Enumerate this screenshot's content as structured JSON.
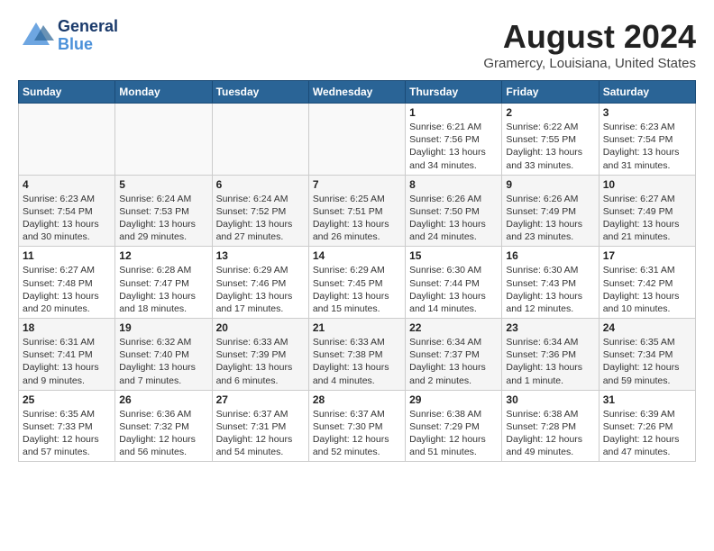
{
  "header": {
    "logo_general": "General",
    "logo_blue": "Blue",
    "month_title": "August 2024",
    "location": "Gramercy, Louisiana, United States"
  },
  "weekdays": [
    "Sunday",
    "Monday",
    "Tuesday",
    "Wednesday",
    "Thursday",
    "Friday",
    "Saturday"
  ],
  "weeks": [
    [
      {
        "day": "",
        "info": ""
      },
      {
        "day": "",
        "info": ""
      },
      {
        "day": "",
        "info": ""
      },
      {
        "day": "",
        "info": ""
      },
      {
        "day": "1",
        "info": "Sunrise: 6:21 AM\nSunset: 7:56 PM\nDaylight: 13 hours\nand 34 minutes."
      },
      {
        "day": "2",
        "info": "Sunrise: 6:22 AM\nSunset: 7:55 PM\nDaylight: 13 hours\nand 33 minutes."
      },
      {
        "day": "3",
        "info": "Sunrise: 6:23 AM\nSunset: 7:54 PM\nDaylight: 13 hours\nand 31 minutes."
      }
    ],
    [
      {
        "day": "4",
        "info": "Sunrise: 6:23 AM\nSunset: 7:54 PM\nDaylight: 13 hours\nand 30 minutes."
      },
      {
        "day": "5",
        "info": "Sunrise: 6:24 AM\nSunset: 7:53 PM\nDaylight: 13 hours\nand 29 minutes."
      },
      {
        "day": "6",
        "info": "Sunrise: 6:24 AM\nSunset: 7:52 PM\nDaylight: 13 hours\nand 27 minutes."
      },
      {
        "day": "7",
        "info": "Sunrise: 6:25 AM\nSunset: 7:51 PM\nDaylight: 13 hours\nand 26 minutes."
      },
      {
        "day": "8",
        "info": "Sunrise: 6:26 AM\nSunset: 7:50 PM\nDaylight: 13 hours\nand 24 minutes."
      },
      {
        "day": "9",
        "info": "Sunrise: 6:26 AM\nSunset: 7:49 PM\nDaylight: 13 hours\nand 23 minutes."
      },
      {
        "day": "10",
        "info": "Sunrise: 6:27 AM\nSunset: 7:49 PM\nDaylight: 13 hours\nand 21 minutes."
      }
    ],
    [
      {
        "day": "11",
        "info": "Sunrise: 6:27 AM\nSunset: 7:48 PM\nDaylight: 13 hours\nand 20 minutes."
      },
      {
        "day": "12",
        "info": "Sunrise: 6:28 AM\nSunset: 7:47 PM\nDaylight: 13 hours\nand 18 minutes."
      },
      {
        "day": "13",
        "info": "Sunrise: 6:29 AM\nSunset: 7:46 PM\nDaylight: 13 hours\nand 17 minutes."
      },
      {
        "day": "14",
        "info": "Sunrise: 6:29 AM\nSunset: 7:45 PM\nDaylight: 13 hours\nand 15 minutes."
      },
      {
        "day": "15",
        "info": "Sunrise: 6:30 AM\nSunset: 7:44 PM\nDaylight: 13 hours\nand 14 minutes."
      },
      {
        "day": "16",
        "info": "Sunrise: 6:30 AM\nSunset: 7:43 PM\nDaylight: 13 hours\nand 12 minutes."
      },
      {
        "day": "17",
        "info": "Sunrise: 6:31 AM\nSunset: 7:42 PM\nDaylight: 13 hours\nand 10 minutes."
      }
    ],
    [
      {
        "day": "18",
        "info": "Sunrise: 6:31 AM\nSunset: 7:41 PM\nDaylight: 13 hours\nand 9 minutes."
      },
      {
        "day": "19",
        "info": "Sunrise: 6:32 AM\nSunset: 7:40 PM\nDaylight: 13 hours\nand 7 minutes."
      },
      {
        "day": "20",
        "info": "Sunrise: 6:33 AM\nSunset: 7:39 PM\nDaylight: 13 hours\nand 6 minutes."
      },
      {
        "day": "21",
        "info": "Sunrise: 6:33 AM\nSunset: 7:38 PM\nDaylight: 13 hours\nand 4 minutes."
      },
      {
        "day": "22",
        "info": "Sunrise: 6:34 AM\nSunset: 7:37 PM\nDaylight: 13 hours\nand 2 minutes."
      },
      {
        "day": "23",
        "info": "Sunrise: 6:34 AM\nSunset: 7:36 PM\nDaylight: 13 hours\nand 1 minute."
      },
      {
        "day": "24",
        "info": "Sunrise: 6:35 AM\nSunset: 7:34 PM\nDaylight: 12 hours\nand 59 minutes."
      }
    ],
    [
      {
        "day": "25",
        "info": "Sunrise: 6:35 AM\nSunset: 7:33 PM\nDaylight: 12 hours\nand 57 minutes."
      },
      {
        "day": "26",
        "info": "Sunrise: 6:36 AM\nSunset: 7:32 PM\nDaylight: 12 hours\nand 56 minutes."
      },
      {
        "day": "27",
        "info": "Sunrise: 6:37 AM\nSunset: 7:31 PM\nDaylight: 12 hours\nand 54 minutes."
      },
      {
        "day": "28",
        "info": "Sunrise: 6:37 AM\nSunset: 7:30 PM\nDaylight: 12 hours\nand 52 minutes."
      },
      {
        "day": "29",
        "info": "Sunrise: 6:38 AM\nSunset: 7:29 PM\nDaylight: 12 hours\nand 51 minutes."
      },
      {
        "day": "30",
        "info": "Sunrise: 6:38 AM\nSunset: 7:28 PM\nDaylight: 12 hours\nand 49 minutes."
      },
      {
        "day": "31",
        "info": "Sunrise: 6:39 AM\nSunset: 7:26 PM\nDaylight: 12 hours\nand 47 minutes."
      }
    ]
  ]
}
